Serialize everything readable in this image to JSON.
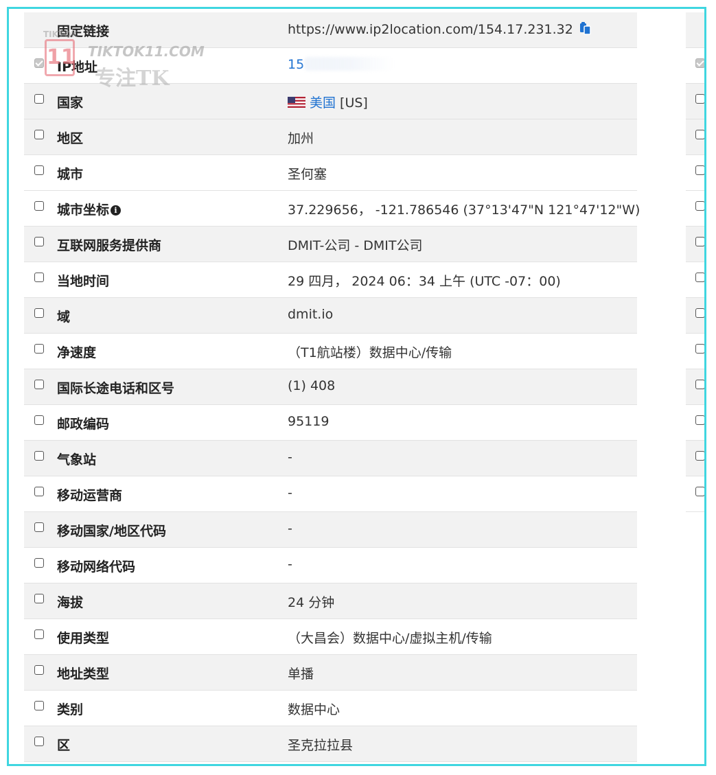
{
  "rows": [
    {
      "label": "固定链接",
      "value": "https://www.ip2location.com/154.17.231.32",
      "icon": "copy-icon",
      "checkbox": "none"
    },
    {
      "label": "IP地址",
      "value": "15",
      "link": true,
      "checkbox": "checked-disabled"
    },
    {
      "label": "国家",
      "value": "美国",
      "suffix": " [US]",
      "link": true,
      "icon": "us-flag-icon"
    },
    {
      "label": "地区",
      "value": "加州"
    },
    {
      "label": "城市",
      "value": "圣何塞"
    },
    {
      "label": "城市坐标",
      "value": "37.229656，  -121.786546   (37°13'47\"N 121°47'12\"W)",
      "icon": "info-icon"
    },
    {
      "label": "互联网服务提供商",
      "value": "DMIT-公司 - DMIT公司"
    },
    {
      "label": "当地时间",
      "value": "29 四月，  2024 06：34 上午   (UTC -07：00)"
    },
    {
      "label": "域",
      "value": "dmit.io"
    },
    {
      "label": "净速度",
      "value": "（T1航站楼）数据中心/传输"
    },
    {
      "label": "国际长途电话和区号",
      "value": "(1) 408"
    },
    {
      "label": "邮政编码",
      "value": "95119"
    },
    {
      "label": "气象站",
      "value": "-"
    },
    {
      "label": "移动运营商",
      "value": "-"
    },
    {
      "label": "移动国家/地区代码",
      "value": "-"
    },
    {
      "label": "移动网络代码",
      "value": "-"
    },
    {
      "label": "海拔",
      "value": "24 分钟"
    },
    {
      "label": "使用类型",
      "value": "（大昌会）数据中心/虚拟主机/传输"
    },
    {
      "label": "地址类型",
      "value": "单播"
    },
    {
      "label": "类别",
      "value": "数据中心"
    },
    {
      "label": "区",
      "value": "圣克拉拉县"
    }
  ],
  "watermark": {
    "small": "TIKTOK",
    "logo": "11",
    "brand": "TIKTOK11.COM",
    "sub": "专注TK"
  },
  "colors": {
    "link": "#1f72d1",
    "frame_border": "#3fd6e0",
    "row_shade": "#f2f2f2"
  }
}
